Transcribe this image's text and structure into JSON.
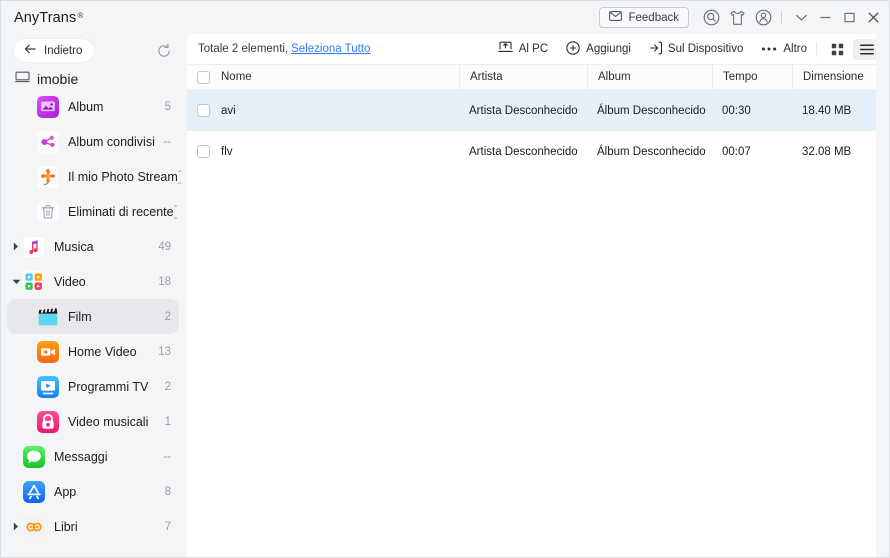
{
  "window": {
    "brand": "AnyTrans",
    "registered_mark": "®",
    "feedback_label": "Feedback",
    "icons": {
      "envelope": "envelope-icon",
      "search": "search-icon",
      "theme": "theme-shirt-icon",
      "account": "account-icon",
      "chevron_down": "chevron-down-icon",
      "minimize": "minimize-icon",
      "maximize": "maximize-icon",
      "close": "close-icon"
    }
  },
  "sidebar": {
    "back_label": "Indietro",
    "refresh_icon": "refresh-icon",
    "device_name": "imobie",
    "items": [
      {
        "label": "Album",
        "count": "5",
        "icon": "album-icon",
        "indent": 1,
        "caret": "",
        "selected": false
      },
      {
        "label": "Album condivisi",
        "count": "--",
        "icon": "shared-album-icon",
        "indent": 1,
        "caret": "",
        "selected": false
      },
      {
        "label": "Il mio Photo Stream",
        "count": "--",
        "icon": "photo-stream-icon",
        "indent": 1,
        "caret": "",
        "selected": false
      },
      {
        "label": "Eliminati di recente",
        "count": "--",
        "icon": "trash-icon",
        "indent": 1,
        "caret": "",
        "selected": false
      },
      {
        "label": "Musica",
        "count": "49",
        "icon": "music-icon",
        "indent": 0,
        "caret": "right",
        "selected": false
      },
      {
        "label": "Video",
        "count": "18",
        "icon": "video-icon",
        "indent": 0,
        "caret": "down",
        "selected": false
      },
      {
        "label": "Film",
        "count": "2",
        "icon": "film-icon",
        "indent": 1,
        "caret": "",
        "selected": true
      },
      {
        "label": "Home Video",
        "count": "13",
        "icon": "home-video-icon",
        "indent": 1,
        "caret": "",
        "selected": false
      },
      {
        "label": "Programmi TV",
        "count": "2",
        "icon": "tv-shows-icon",
        "indent": 1,
        "caret": "",
        "selected": false
      },
      {
        "label": "Video musicali",
        "count": "1",
        "icon": "music-video-icon",
        "indent": 1,
        "caret": "",
        "selected": false
      },
      {
        "label": "Messaggi",
        "count": "--",
        "icon": "messages-icon",
        "indent": 0,
        "caret": "",
        "selected": false
      },
      {
        "label": "App",
        "count": "8",
        "icon": "app-store-icon",
        "indent": 0,
        "caret": "",
        "selected": false
      },
      {
        "label": "Libri",
        "count": "7",
        "icon": "books-icon",
        "indent": 0,
        "caret": "right",
        "selected": false
      }
    ]
  },
  "main": {
    "total_text": "Totale 2 elementi,",
    "select_all_label": "Seleziona Tutto",
    "actions": [
      {
        "label": "Al PC",
        "icon": "export-to-pc-icon"
      },
      {
        "label": "Aggiungi",
        "icon": "plus-circle-icon"
      },
      {
        "label": "Sul Dispositivo",
        "icon": "to-device-icon"
      },
      {
        "label": "Altro",
        "icon": "more-dots-icon"
      }
    ],
    "view_modes": [
      {
        "name": "grid-view",
        "active": false
      },
      {
        "name": "list-view",
        "active": true
      }
    ],
    "columns": [
      "Nome",
      "Artista",
      "Album",
      "Tempo",
      "Dimensione"
    ],
    "rows": [
      {
        "name": "avi",
        "artist": "Artista Desconhecido",
        "album": "Álbum Desconhecido",
        "time": "00:30",
        "size": "18.40 MB",
        "selected": true
      },
      {
        "name": "flv",
        "artist": "Artista Desconhecido",
        "album": "Álbum Desconhecido",
        "time": "00:07",
        "size": "32.08 MB",
        "selected": false
      }
    ]
  },
  "colors": {
    "accent_link": "#3478f6",
    "row_selected": "#e6f0fb",
    "sidebar_bg": "#f4f5f7",
    "nav_selected": "#e7e8eb"
  }
}
